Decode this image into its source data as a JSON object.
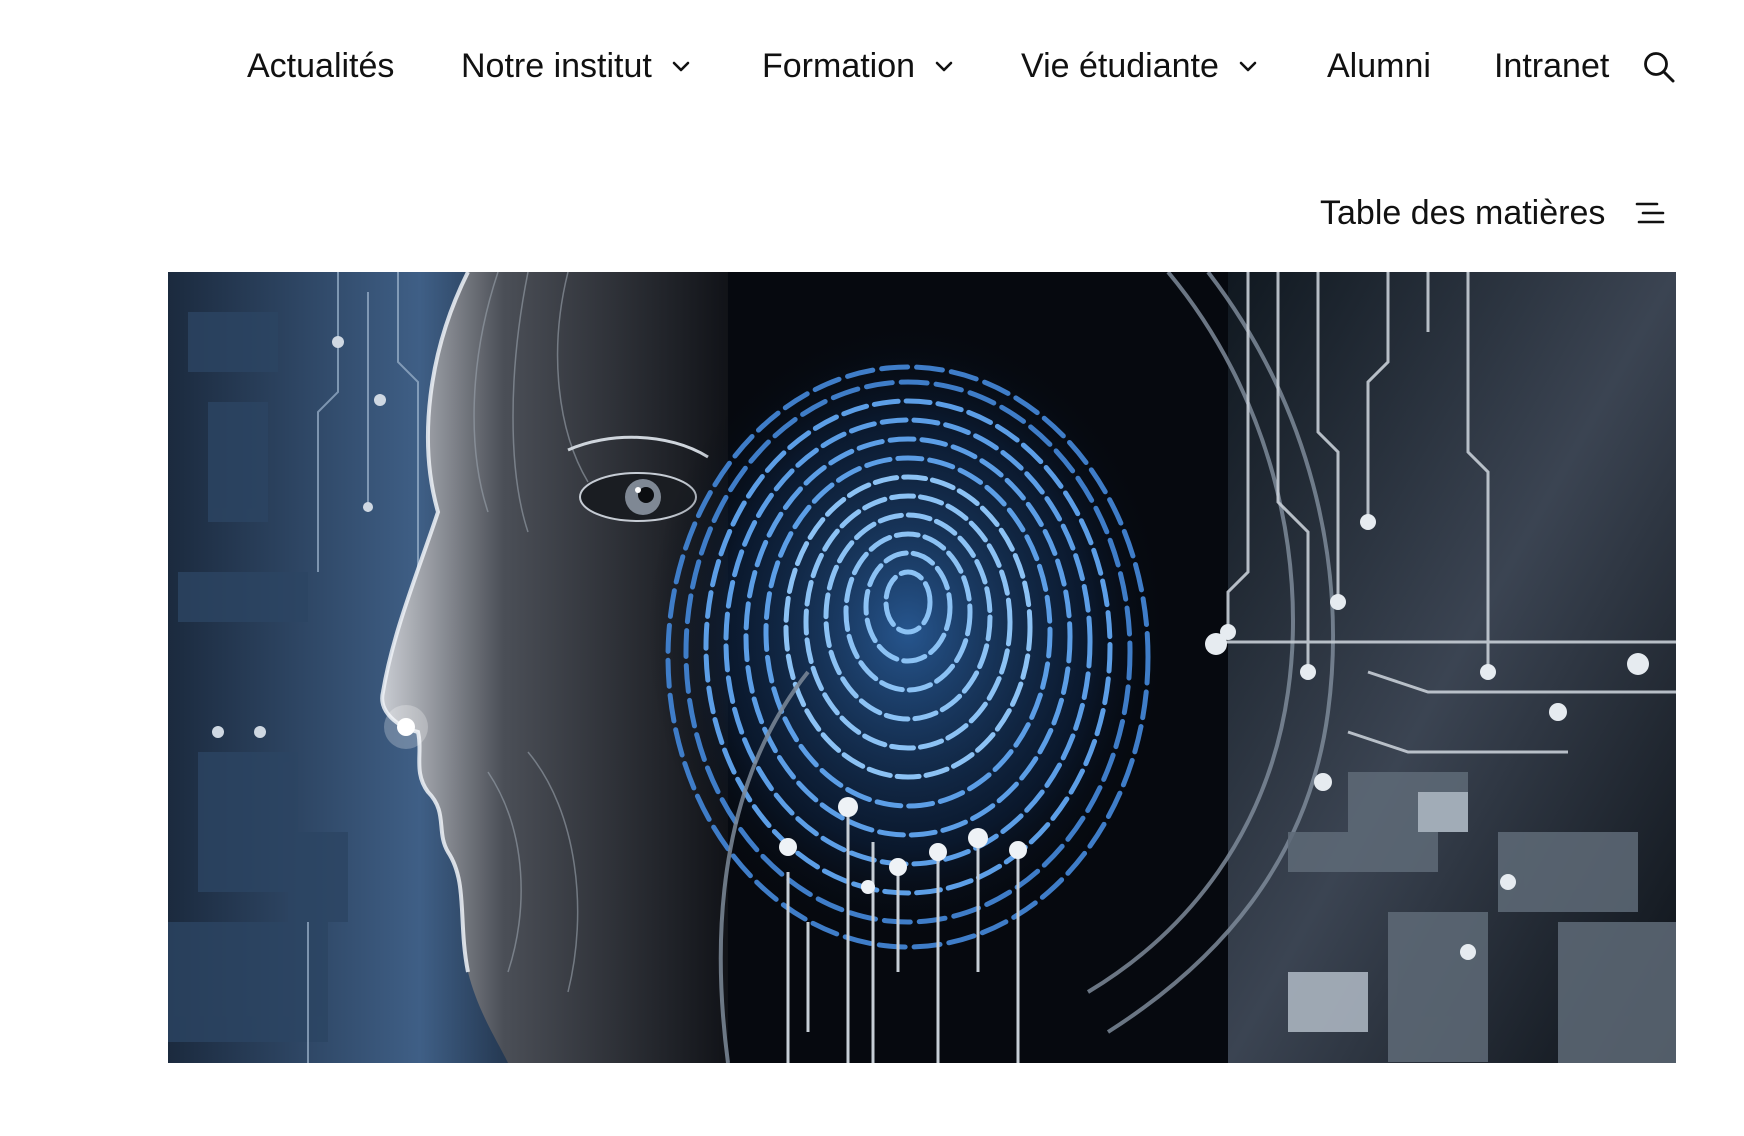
{
  "nav": {
    "items": [
      {
        "label": "Actualités",
        "has_dropdown": false
      },
      {
        "label": "Notre institut",
        "has_dropdown": true
      },
      {
        "label": "Formation",
        "has_dropdown": true
      },
      {
        "label": "Vie étudiante",
        "has_dropdown": true
      },
      {
        "label": "Alumni",
        "has_dropdown": false
      },
      {
        "label": "Intranet",
        "has_dropdown": false
      }
    ],
    "search_icon": "search-icon",
    "dropdown_icon": "chevron-down-icon"
  },
  "toc": {
    "label": "Table des matières",
    "icon": "list-icon"
  },
  "hero": {
    "description_icon": "face-fingerprint-circuit-illustration",
    "palette": {
      "dark": "#06090f",
      "blue": "#4f8fd8",
      "light": "#cfe4ff",
      "grey": "#8c99a8"
    }
  }
}
